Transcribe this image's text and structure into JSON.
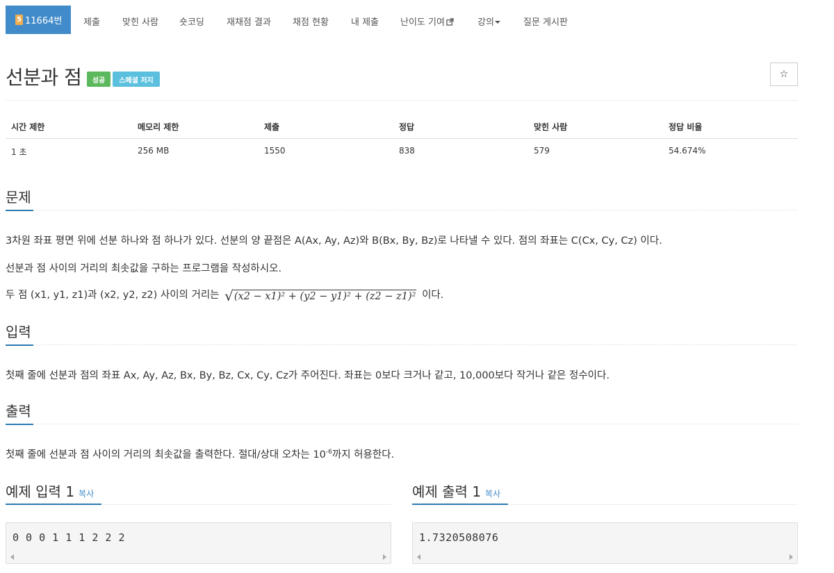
{
  "nav": {
    "active": {
      "badge": "5",
      "label": "11664번"
    },
    "items": [
      "제출",
      "맞힌 사람",
      "숏코딩",
      "재채점 결과",
      "채점 현황",
      "내 제출",
      "난이도 기여",
      "강의",
      "질문 게시판"
    ]
  },
  "problem": {
    "title": "선분과 점",
    "labels": {
      "success": "성공",
      "special": "스페셜 저지"
    },
    "star": "☆"
  },
  "stats": {
    "headers": [
      "시간 제한",
      "메모리 제한",
      "제출",
      "정답",
      "맞힌 사람",
      "정답 비율"
    ],
    "values": [
      "1 초",
      "256 MB",
      "1550",
      "838",
      "579",
      "54.674%"
    ]
  },
  "sections": {
    "problem": {
      "title": "문제",
      "line1": "3차원 좌표 평면 위에 선분 하나와 점 하나가 있다. 선분의 양 끝점은 A(Ax, Ay, Az)와 B(Bx, By, Bz)로 나타낼 수 있다. 점의 좌표는 C(Cx, Cy, Cz) 이다.",
      "line2": "선분과 점 사이의 거리의 최솟값을 구하는 프로그램을 작성하시오.",
      "line3_prefix": "두 점 (x1, y1, z1)과 (x2, y2, z2) 사이의 거리는",
      "formula": "(x2 − x1)² + (y2 − y1)² + (z2 − z1)²",
      "line3_suffix": "이다."
    },
    "input": {
      "title": "입력",
      "text": "첫째 줄에 선분과 점의 좌표 Ax, Ay, Az, Bx, By, Bz, Cx, Cy, Cz가 주어진다. 좌표는 0보다 크거나 같고, 10,000보다 작거나 같은 정수이다."
    },
    "output": {
      "title": "출력",
      "text_prefix": "첫째 줄에 선분과 점 사이의 거리의 최솟값을 출력한다. 절대/상대 오차는 10",
      "text_sup": "-6",
      "text_suffix": "까지 허용한다."
    }
  },
  "samples": {
    "input": {
      "title": "예제 입력 1",
      "copy": "복사",
      "content": "0 0 0 1 1 1 2 2 2"
    },
    "output": {
      "title": "예제 출력 1",
      "copy": "복사",
      "content": "1.7320508076"
    }
  }
}
